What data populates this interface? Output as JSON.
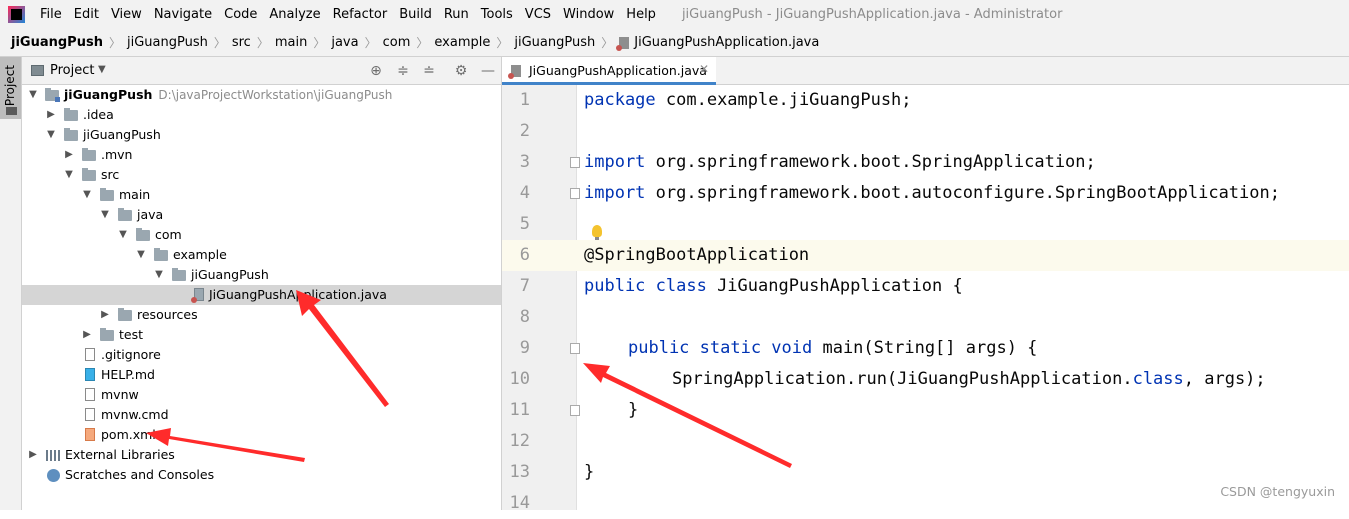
{
  "menu": {
    "items": [
      "File",
      "Edit",
      "View",
      "Navigate",
      "Code",
      "Analyze",
      "Refactor",
      "Build",
      "Run",
      "Tools",
      "VCS",
      "Window",
      "Help"
    ],
    "window_title": "jiGuangPush - JiGuangPushApplication.java - Administrator"
  },
  "breadcrumb": [
    "jiGuangPush",
    "jiGuangPush",
    "src",
    "main",
    "java",
    "com",
    "example",
    "jiGuangPush",
    "JiGuangPushApplication.java"
  ],
  "toolstrip": {
    "label": "Project"
  },
  "project_panel": {
    "title": "Project",
    "tree": [
      {
        "label": "jiGuangPush",
        "path": "D:\\javaProjectWorkstation\\jiGuangPush",
        "icon": "module-folder-icon",
        "chevron": "down"
      },
      {
        "label": ".idea",
        "icon": "folder-icon",
        "chevron": "right"
      },
      {
        "label": "jiGuangPush",
        "icon": "folder-icon",
        "chevron": "down"
      },
      {
        "label": ".mvn",
        "icon": "folder-icon",
        "chevron": "right"
      },
      {
        "label": "src",
        "icon": "folder-icon",
        "chevron": "down"
      },
      {
        "label": "main",
        "icon": "folder-icon",
        "chevron": "down"
      },
      {
        "label": "java",
        "icon": "folder-icon",
        "chevron": "down"
      },
      {
        "label": "com",
        "icon": "folder-icon",
        "chevron": "down"
      },
      {
        "label": "example",
        "icon": "folder-icon",
        "chevron": "down"
      },
      {
        "label": "jiGuangPush",
        "icon": "folder-icon",
        "chevron": "down"
      },
      {
        "label": "JiGuangPushApplication.java",
        "icon": "java-file-icon",
        "chevron": ""
      },
      {
        "label": "resources",
        "icon": "folder-icon",
        "chevron": "right"
      },
      {
        "label": "test",
        "icon": "folder-icon",
        "chevron": "right"
      },
      {
        "label": ".gitignore",
        "icon": "file-icon",
        "chevron": ""
      },
      {
        "label": "HELP.md",
        "icon": "markdown-file-icon",
        "chevron": ""
      },
      {
        "label": "mvnw",
        "icon": "file-icon",
        "chevron": ""
      },
      {
        "label": "mvnw.cmd",
        "icon": "file-icon",
        "chevron": ""
      },
      {
        "label": "pom.xml",
        "icon": "xml-file-icon",
        "chevron": ""
      },
      {
        "label": "External Libraries",
        "icon": "library-icon",
        "chevron": "right"
      },
      {
        "label": "Scratches and Consoles",
        "icon": "scratch-icon",
        "chevron": ""
      }
    ]
  },
  "editor": {
    "tab_label": "JiGuangPushApplication.java",
    "line_numbers": [
      "1",
      "2",
      "3",
      "4",
      "5",
      "6",
      "7",
      "8",
      "9",
      "10",
      "11",
      "12",
      "13",
      "14"
    ],
    "code": {
      "l1_kw": "package",
      "l1_rest": " com.example.jiGuangPush;",
      "l3_kw": "import",
      "l3_rest": " org.springframework.boot.SpringApplication;",
      "l4_kw": "import",
      "l4_rest": " org.springframework.boot.autoconfigure.SpringBootApplication;",
      "l6": "@SpringBootApplication",
      "l7_kw": "public class",
      "l7_rest": " JiGuangPushApplication {",
      "l9_kw": "public static void",
      "l9_rest": " main(String[] args) {",
      "l10_a": "SpringApplication.run(JiGuangPushApplication.",
      "l10_kw": "class",
      "l10_b": ", args);",
      "l11": "}",
      "l13": "}"
    }
  },
  "watermark": "CSDN @tengyuxin",
  "colors": {
    "arrow": "#ff2b2b",
    "keyword": "#0033b3",
    "selection": "#d5d5d5"
  }
}
